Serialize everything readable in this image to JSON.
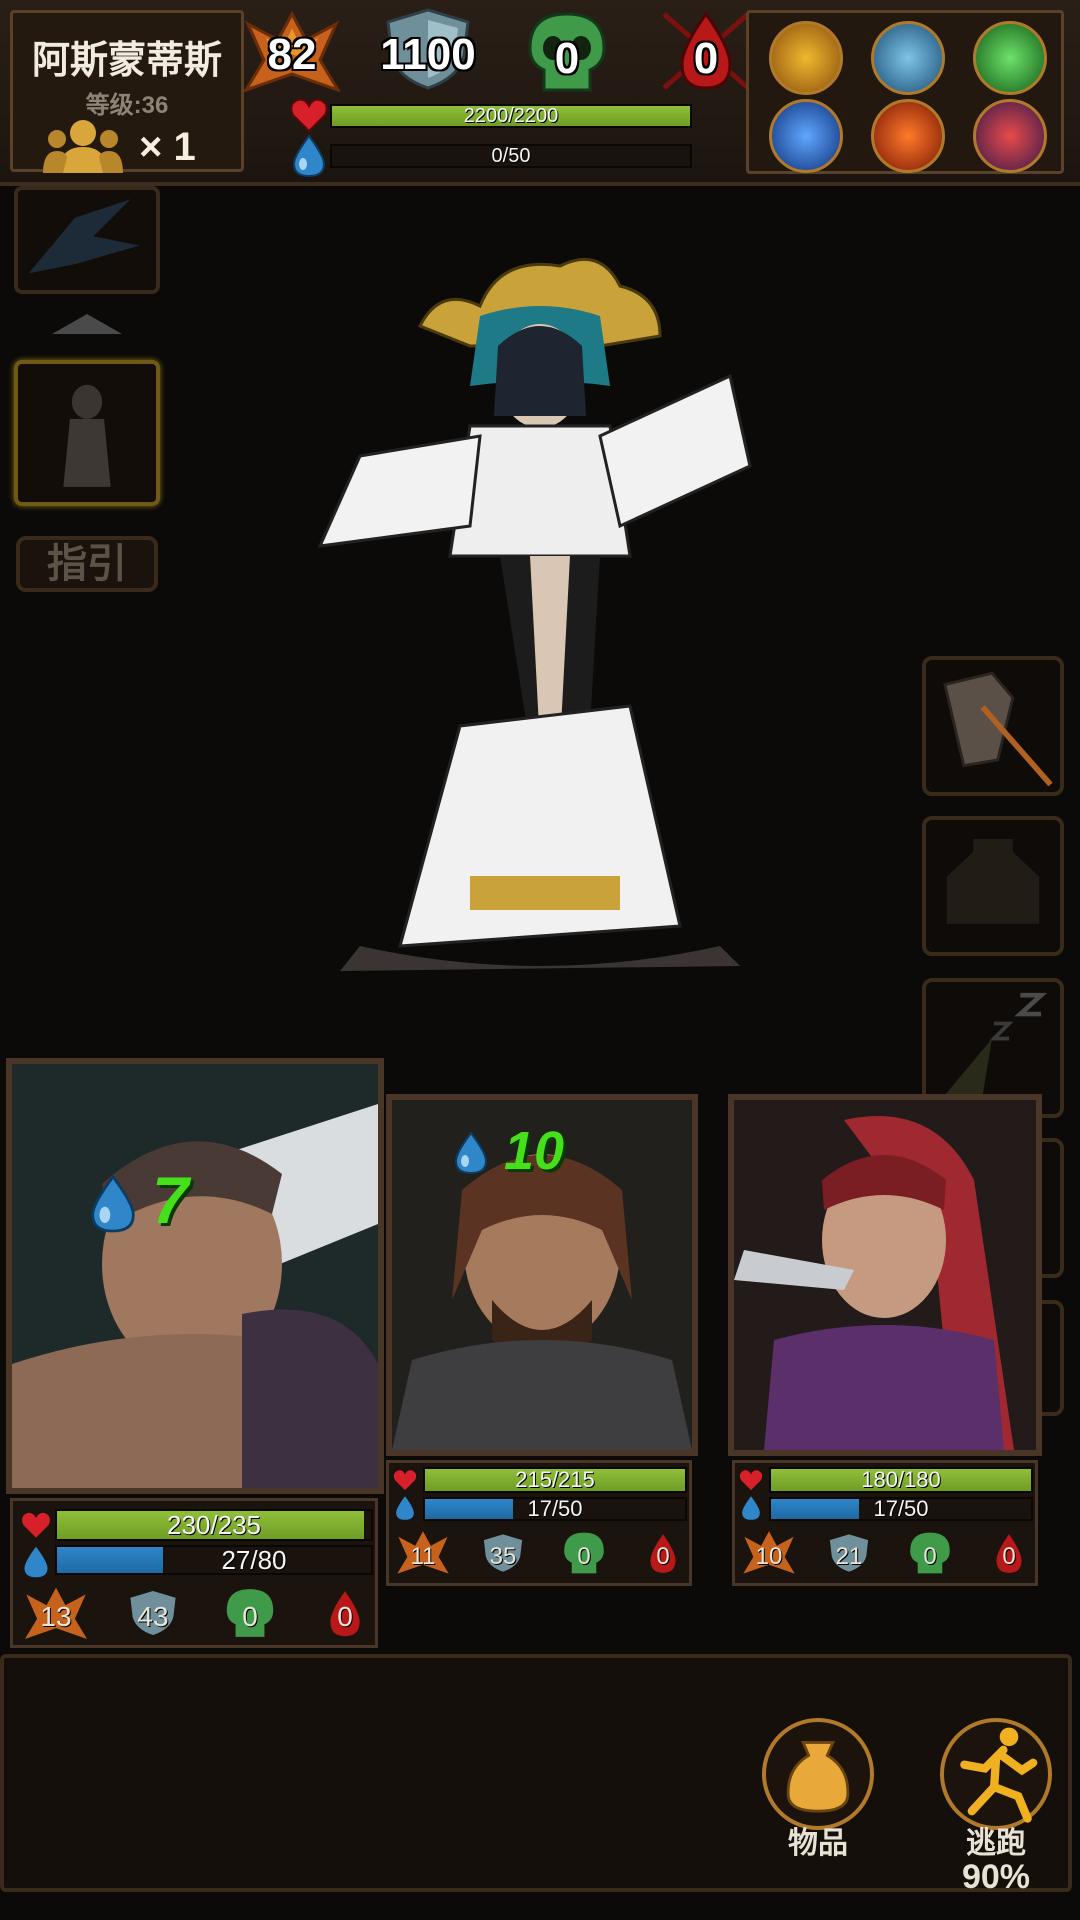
{
  "boss": {
    "name": "阿斯蒙蒂斯",
    "level_text": "等级:36",
    "party_count": "× 1",
    "attack": "82",
    "defense": "1100",
    "poison": "0",
    "bleed": "0",
    "hp_text": "2200/2200",
    "hp_fraction": 1.0,
    "mp_text": "0/50",
    "mp_fraction": 0.0
  },
  "skills": [
    {
      "name": "golden-slash-skill-icon"
    },
    {
      "name": "ice-skill-icon"
    },
    {
      "name": "poison-blade-skill-icon"
    },
    {
      "name": "vortex-skill-icon"
    },
    {
      "name": "fire-slash-skill-icon"
    },
    {
      "name": "blood-demon-skill-icon"
    }
  ],
  "left_panel": {
    "guide_label": "指引"
  },
  "heroes": [
    {
      "drop_value": "7",
      "hp_text": "230/235",
      "hp_fraction": 0.979,
      "mp_text": "27/80",
      "mp_fraction": 0.3375,
      "attack": "13",
      "defense": "43",
      "poison": "0",
      "bleed": "0"
    },
    {
      "drop_value": "10",
      "hp_text": "215/215",
      "hp_fraction": 1.0,
      "mp_text": "17/50",
      "mp_fraction": 0.34,
      "attack": "11",
      "defense": "35",
      "poison": "0",
      "bleed": "0"
    },
    {
      "drop_value": "",
      "hp_text": "180/180",
      "hp_fraction": 1.0,
      "mp_text": "17/50",
      "mp_fraction": 0.34,
      "attack": "10",
      "defense": "21",
      "poison": "0",
      "bleed": "0"
    }
  ],
  "actions": {
    "items_label": "物品",
    "flee_label": "逃跑",
    "flee_chance": "90%"
  },
  "colors": {
    "hp": "#8fbf3a",
    "mp": "#2f86c9",
    "drop_text": "#46e01a",
    "frame": "#4a3626"
  }
}
